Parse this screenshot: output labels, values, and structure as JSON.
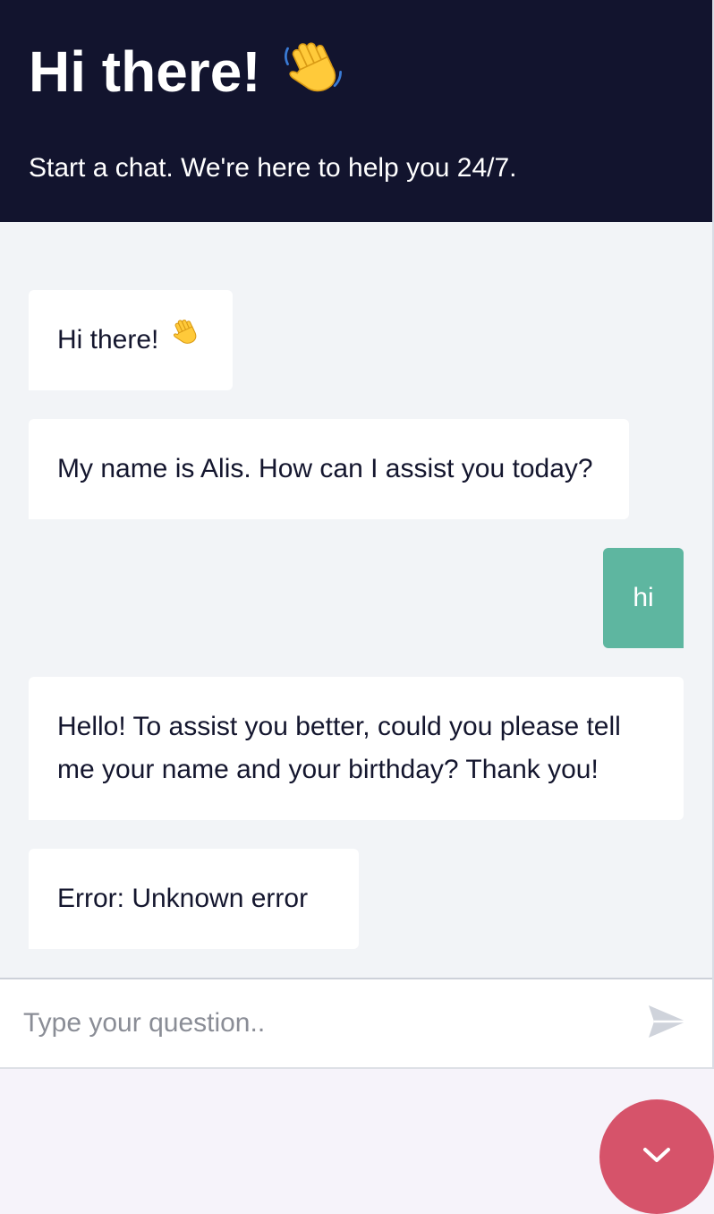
{
  "header": {
    "title": "Hi there!",
    "title_icon": "waving-hand-emoji",
    "subtitle": "Start a chat. We're here to help you 24/7."
  },
  "messages": [
    {
      "sender": "bot",
      "text": "Hi there!",
      "icon": "waving-hand-emoji"
    },
    {
      "sender": "bot",
      "text": "My name is Alis. How can I assist you today?"
    },
    {
      "sender": "user",
      "text": "hi"
    },
    {
      "sender": "bot",
      "text": "Hello! To assist you better, could you please tell me your name and your birthday? Thank you!"
    },
    {
      "sender": "bot",
      "text": "Error: Unknown error"
    }
  ],
  "composer": {
    "placeholder": "Type your question..",
    "value": "",
    "send_icon": "send-icon"
  },
  "launcher": {
    "icon": "chevron-down-icon"
  },
  "colors": {
    "header_bg": "#12142e",
    "chat_bg": "#f2f4f7",
    "user_bubble": "#5eb6a0",
    "launcher_bg": "#d6536a"
  }
}
